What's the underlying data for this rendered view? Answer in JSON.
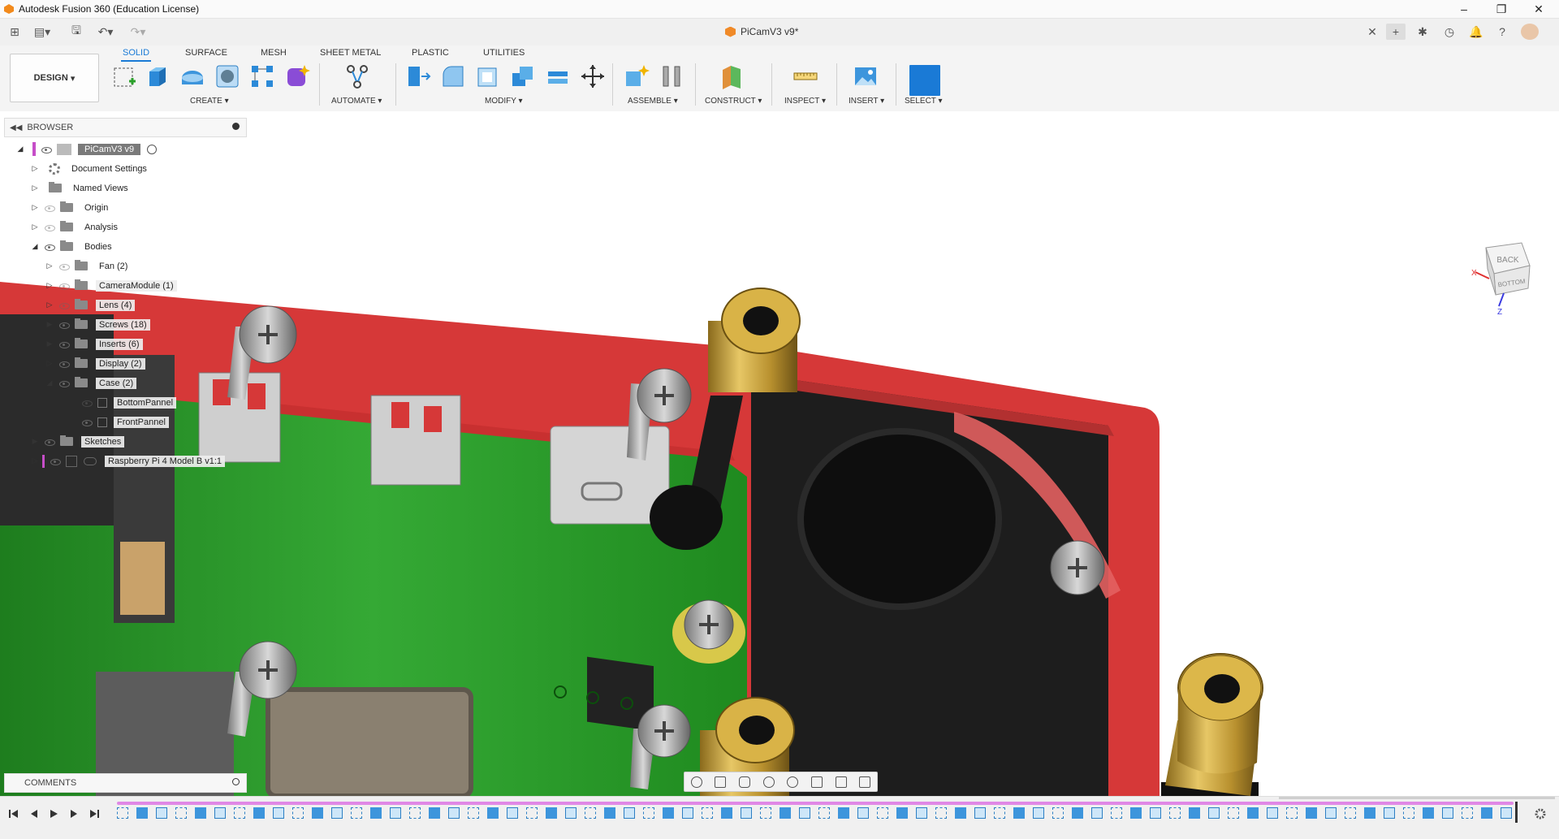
{
  "window": {
    "title": "Autodesk Fusion 360 (Education License)"
  },
  "document": {
    "tab_title": "PiCamV3 v9*"
  },
  "ribbon": {
    "workspace": "DESIGN",
    "tabs": [
      "SOLID",
      "SURFACE",
      "MESH",
      "SHEET METAL",
      "PLASTIC",
      "UTILITIES"
    ],
    "active_tab": "SOLID",
    "groups": [
      "CREATE",
      "AUTOMATE",
      "MODIFY",
      "ASSEMBLE",
      "CONSTRUCT",
      "INSPECT",
      "INSERT",
      "SELECT"
    ]
  },
  "browser": {
    "title": "BROWSER",
    "items": [
      {
        "label": "PiCamV3 v9"
      },
      {
        "label": "Document Settings"
      },
      {
        "label": "Named Views"
      },
      {
        "label": "Origin"
      },
      {
        "label": "Analysis"
      },
      {
        "label": "Bodies"
      },
      {
        "label": "Fan (2)"
      },
      {
        "label": "CameraModule (1)"
      },
      {
        "label": "Lens (4)"
      },
      {
        "label": "Screws (18)"
      },
      {
        "label": "Inserts (6)"
      },
      {
        "label": "Display (2)"
      },
      {
        "label": "Case (2)"
      },
      {
        "label": "BottomPannel"
      },
      {
        "label": "FrontPannel"
      },
      {
        "label": "Sketches"
      },
      {
        "label": "Raspberry Pi 4 Model B v1:1"
      }
    ]
  },
  "comments": {
    "title": "COMMENTS"
  },
  "viewcube": {
    "top_face": "BACK",
    "front_face": "BOTTOM",
    "axis_x": "X",
    "axis_z": "Z"
  },
  "colors": {
    "accent": "#1a7ad6",
    "case_red": "#d63a3a",
    "pcb_green": "#2e9a2e",
    "brass": "#c8a03a",
    "timeline": "#e088e6"
  }
}
